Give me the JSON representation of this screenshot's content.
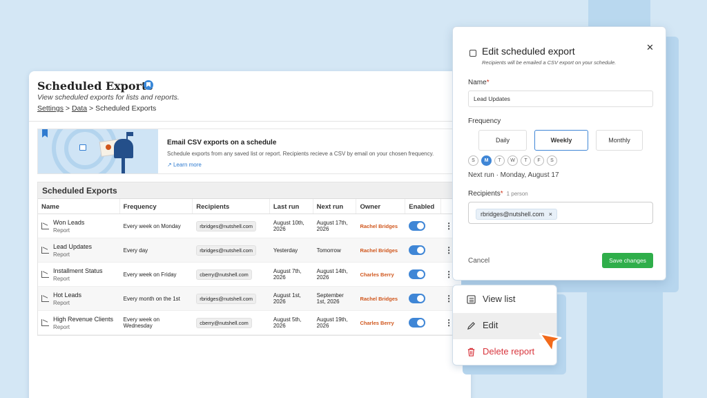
{
  "page": {
    "title": "Scheduled Exports",
    "subtitle": "View scheduled exports for lists and reports.",
    "breadcrumb": [
      "Settings",
      "Data",
      "Scheduled Exports"
    ],
    "breadcrumb_sep": ">"
  },
  "banner": {
    "title": "Email CSV exports on a schedule",
    "description": "Schedule exports from any saved list or report. Recipients recieve a CSV by email on your chosen frequency.",
    "link": "Learn more"
  },
  "table": {
    "title": "Scheduled Exports",
    "columns": [
      "Name",
      "Frequency",
      "Recipients",
      "Last run",
      "Next run",
      "Owner",
      "Enabled"
    ],
    "rows": [
      {
        "name": "Won Leads",
        "type": "Report",
        "frequency": "Every week on Monday",
        "recipients": "rbridges@nutshell.com",
        "last_run": "August 10th, 2026",
        "next_run": "August 17th, 2026",
        "owner": "Rachel Bridges",
        "enabled": true
      },
      {
        "name": "Lead Updates",
        "type": "Report",
        "frequency": "Every day",
        "recipients": "rbridges@nutshell.com",
        "last_run": "Yesterday",
        "next_run": "Tomorrow",
        "owner": "Rachel Bridges",
        "enabled": true
      },
      {
        "name": "Installment Status",
        "type": "Report",
        "frequency": "Every week on Friday",
        "recipients": "cberry@nutshell.com",
        "last_run": "August 7th, 2026",
        "next_run": "August 14th, 2026",
        "owner": "Charles Berry",
        "enabled": true
      },
      {
        "name": "Hot Leads",
        "type": "Report",
        "frequency": "Every month on the 1st",
        "recipients": "rbridges@nutshell.com",
        "last_run": "August 1st, 2026",
        "next_run": "September 1st, 2026",
        "owner": "Rachel Bridges",
        "enabled": true
      },
      {
        "name": "High Revenue Clients",
        "type": "Report",
        "frequency": "Every week on Wednesday",
        "recipients": "cberry@nutshell.com",
        "last_run": "August 5th, 2026",
        "next_run": "August 19th, 2026",
        "owner": "Charles Berry",
        "enabled": true
      }
    ]
  },
  "modal": {
    "title": "Edit scheduled export",
    "subtitle": "Recipients will be emailed a CSV export on your schedule.",
    "name_label": "Name",
    "name_value": "Lead Updates",
    "frequency_label": "Frequency",
    "frequency_options": [
      "Daily",
      "Weekly",
      "Monthly"
    ],
    "frequency_selected": "Weekly",
    "days": [
      "S",
      "M",
      "T",
      "W",
      "T",
      "F",
      "S"
    ],
    "day_selected": "M",
    "next_run": "Next run · Monday, August 17",
    "recipients_label": "Recipients",
    "recipients_count": "1 person",
    "recipient": "rbridges@nutshell.com",
    "cancel": "Cancel",
    "save": "Save changes"
  },
  "context_menu": {
    "items": [
      "View list",
      "Edit",
      "Delete report"
    ]
  },
  "colors": {
    "accent": "#3f86d6",
    "save": "#2fae4a",
    "danger": "#d8343c",
    "owner": "#d0561c",
    "cursor": "#f26a1b"
  }
}
